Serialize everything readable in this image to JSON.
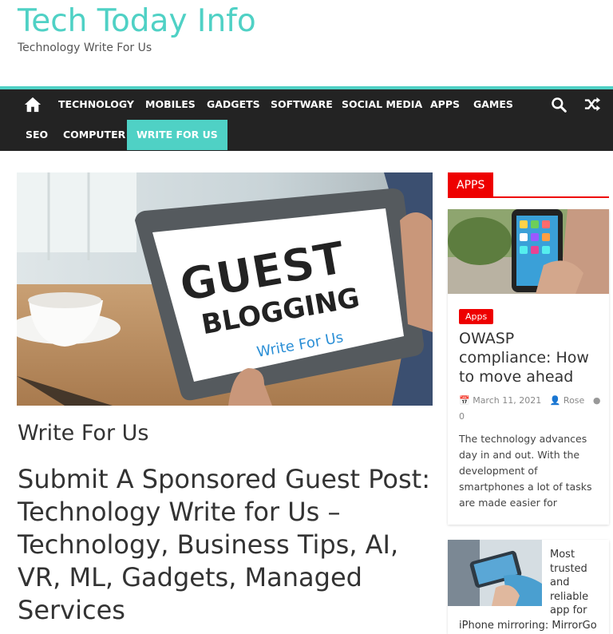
{
  "header": {
    "site_title": "Tech Today Info",
    "site_description": "Technology Write For Us"
  },
  "nav": {
    "items": [
      {
        "label": "TECHNOLOGY"
      },
      {
        "label": "MOBILES"
      },
      {
        "label": "GADGETS"
      },
      {
        "label": "SOFTWARE"
      },
      {
        "label": "SOCIAL MEDIA"
      },
      {
        "label": "APPS"
      },
      {
        "label": "GAMES"
      },
      {
        "label": "SEO"
      },
      {
        "label": "COMPUTER"
      },
      {
        "label": "WRITE FOR US",
        "active": true
      }
    ]
  },
  "main": {
    "hero_image": {
      "text_line1": "GUEST",
      "text_line2": "BLOGGING",
      "text_line3": "Write For Us"
    },
    "category": "Write For Us",
    "title": "Submit A Sponsored Guest Post: Technology Write for Us – Technology, Business Tips, AI, VR, ML, Gadgets, Managed Services"
  },
  "sidebar": {
    "widget_title": "APPS",
    "featured": {
      "badge": "Apps",
      "title": "OWASP compliance: How to move ahead",
      "date": "March 11, 2021",
      "author": "Rose",
      "comments": "0",
      "excerpt": "The technology advances day in and out. With the development of smartphones a lot of tasks are made easier for"
    },
    "second": {
      "title_part1": "Most trusted and reliable app for",
      "title_part2": "iPhone mirroring: MirrorGo"
    }
  },
  "colors": {
    "accent": "#4fd1c5",
    "nav_bg": "#232323",
    "widget_red": "#ee0000"
  }
}
